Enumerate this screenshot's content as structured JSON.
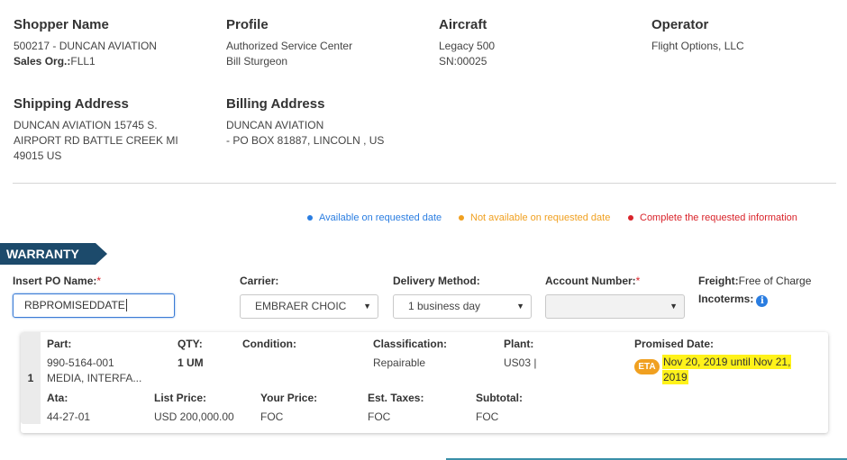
{
  "shopper": {
    "heading": "Shopper Name",
    "line1": "500217 - DUNCAN AVIATION",
    "sales_org_label": "Sales Org.:",
    "sales_org_value": "FLL1"
  },
  "profile": {
    "heading": "Profile",
    "line1": "Authorized Service Center",
    "line2": "Bill Sturgeon"
  },
  "aircraft": {
    "heading": "Aircraft",
    "line1": "Legacy 500",
    "line2": "SN:00025"
  },
  "operator": {
    "heading": "Operator",
    "line1": "Flight Options, LLC"
  },
  "shipping": {
    "heading": "Shipping Address",
    "line1": "DUNCAN AVIATION 15745 S.",
    "line2": "AIRPORT RD BATTLE CREEK MI",
    "line3": "49015 US"
  },
  "billing": {
    "heading": "Billing Address",
    "line1": "DUNCAN AVIATION",
    "line2": "- PO BOX 81887, LINCOLN , US"
  },
  "legend": {
    "available": {
      "label": "Available on requested date",
      "color": "#2a7de1"
    },
    "not_available": {
      "label": "Not available on requested date",
      "color": "#f0a020"
    },
    "complete": {
      "label": "Complete the requested information",
      "color": "#d9232a"
    }
  },
  "section_title": "WARRANTY",
  "form": {
    "po_label": "Insert PO Name:",
    "po_required": "*",
    "po_value": "RBPROMISEDDATE",
    "carrier_label": "Carrier:",
    "carrier_value": "EMBRAER CHOIC",
    "delivery_label": "Delivery Method:",
    "delivery_value": "1 business day",
    "account_label": "Account Number:",
    "account_required": "*",
    "account_value": "",
    "freight_label": "Freight:",
    "freight_value": "Free of Charge",
    "incoterms_label": "Incoterms:"
  },
  "item": {
    "index": "1",
    "part_label": "Part:",
    "part_value_1": "990-5164-001",
    "part_value_2": "MEDIA, INTERFA...",
    "qty_label": "QTY:",
    "qty_value": "1 UM",
    "condition_label": "Condition:",
    "classification_label": "Classification:",
    "classification_value": "Repairable",
    "plant_label": "Plant:",
    "plant_value": "US03 |",
    "promised_label": "Promised Date:",
    "eta_badge": "ETA",
    "promised_value_1": "Nov 20, 2019 until Nov 21,",
    "promised_value_2": "2019",
    "ata_label": "Ata:",
    "ata_value": "44-27-01",
    "list_price_label": "List Price:",
    "list_price_value": "USD 200,000.00",
    "your_price_label": "Your Price:",
    "your_price_value": "FOC",
    "taxes_label": "Est. Taxes:",
    "taxes_value": "FOC",
    "subtotal_label": "Subtotal:",
    "subtotal_value": "FOC"
  }
}
